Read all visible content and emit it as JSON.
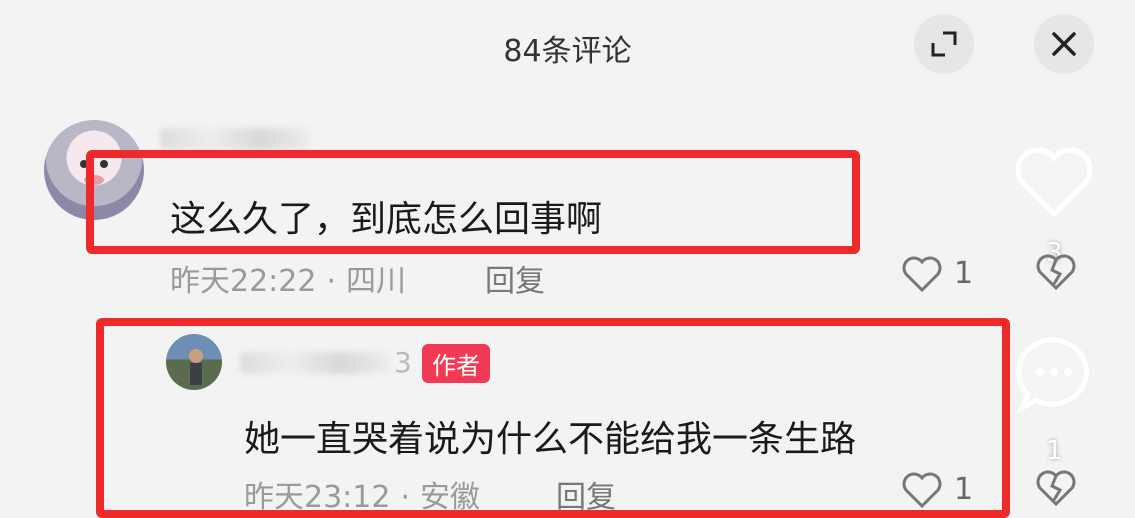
{
  "header": {
    "title": "84条评论"
  },
  "comments": [
    {
      "text": "这么久了，到底怎么回事啊",
      "time": "昨天22:22",
      "location": "四川",
      "reply_label": "回复",
      "likes": "1"
    },
    {
      "username_suffix": "3",
      "badge": "作者",
      "text": "她一直哭着说为什么不能给我一条生路",
      "time": "昨天23:12",
      "location": "安徽",
      "reply_label": "回复",
      "likes": "1"
    }
  ],
  "side": {
    "like_count": "3",
    "comment_count": "1"
  },
  "icons": [
    "expand-icon",
    "close-icon",
    "heart-icon",
    "broken-heart-icon",
    "comment-bubble-icon"
  ],
  "colors": {
    "highlight": "#ee2a2a",
    "badge": "#f23a55"
  }
}
